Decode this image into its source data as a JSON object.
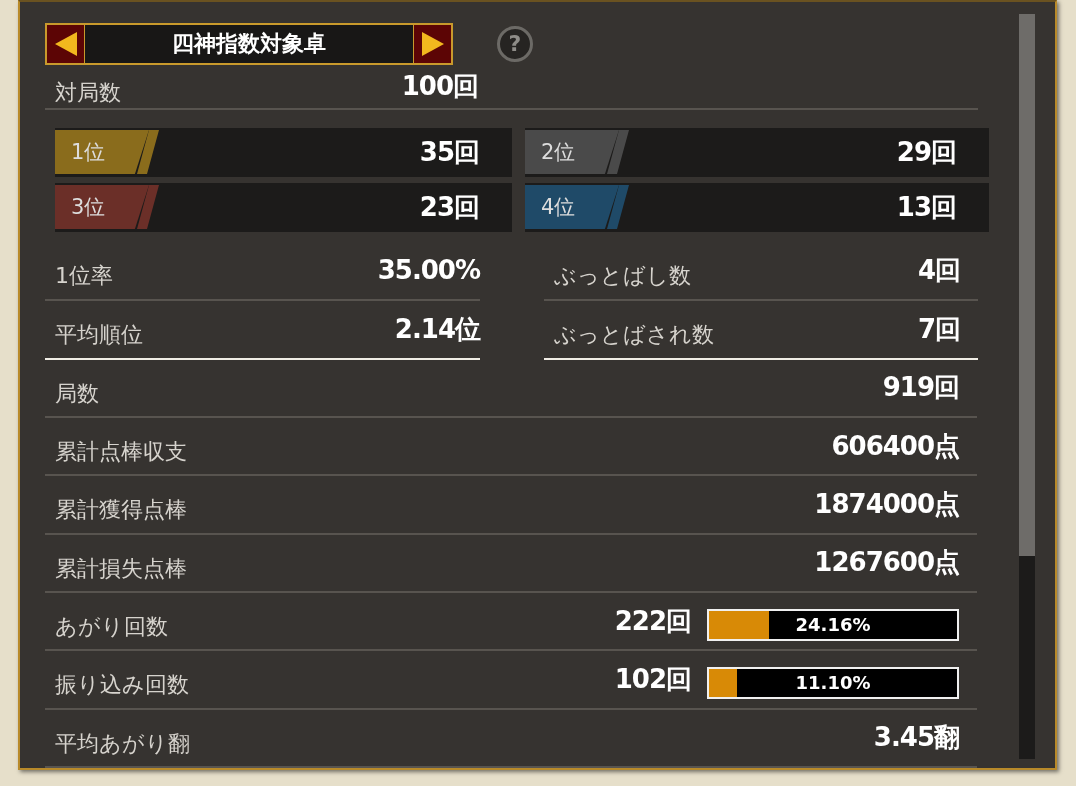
{
  "header": {
    "title": "四神指数対象卓",
    "help": "?"
  },
  "games": {
    "label": "対局数",
    "value": "100回"
  },
  "ranks": [
    {
      "label": "1位",
      "value": "35回",
      "color": "#8a6c1c"
    },
    {
      "label": "2位",
      "value": "29回",
      "color": "#4a4a4a"
    },
    {
      "label": "3位",
      "value": "23回",
      "color": "#6b2f28"
    },
    {
      "label": "4位",
      "value": "13回",
      "color": "#1f4a68"
    }
  ],
  "summary": [
    {
      "label": "1位率",
      "value": "35.00%"
    },
    {
      "label": "ぶっとばし数",
      "value": "4回"
    },
    {
      "label": "平均順位",
      "value": "2.14位"
    },
    {
      "label": "ぶっとばされ数",
      "value": "7回"
    }
  ],
  "stats": [
    {
      "kind": "plain",
      "label": "局数",
      "value": "919回"
    },
    {
      "kind": "plain",
      "label": "累計点棒収支",
      "value": "606400点"
    },
    {
      "kind": "plain",
      "label": "累計獲得点棒",
      "value": "1874000点"
    },
    {
      "kind": "plain",
      "label": "累計損失点棒",
      "value": "1267600点"
    },
    {
      "kind": "rate",
      "label": "あがり回数",
      "value": "222回",
      "rate": "24.16%",
      "level": 0.2416
    },
    {
      "kind": "rate",
      "label": "振り込み回数",
      "value": "102回",
      "rate": "11.10%",
      "level": 0.111
    },
    {
      "kind": "plain",
      "label": "平均あがり翻",
      "value": "3.45翻"
    }
  ]
}
